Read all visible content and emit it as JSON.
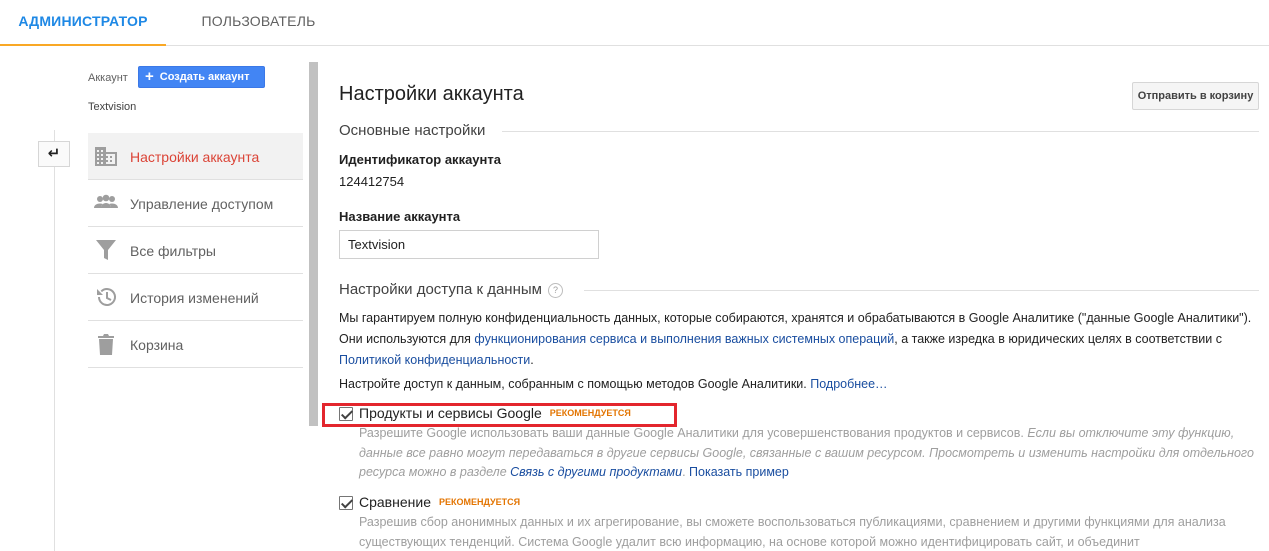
{
  "tabs": {
    "admin": "Администратор",
    "user": "Пользователь"
  },
  "sidebar": {
    "account_label": "Аккаунт",
    "create_button": "Создать аккаунт",
    "account_name": "Textvision",
    "back_icon": "back-arrow-icon",
    "items": [
      {
        "label": "Настройки аккаунта",
        "icon": "building-icon",
        "active": true
      },
      {
        "label": "Управление доступом",
        "icon": "people-icon",
        "active": false
      },
      {
        "label": "Все фильтры",
        "icon": "filter-icon",
        "active": false
      },
      {
        "label": "История изменений",
        "icon": "history-icon",
        "active": false
      },
      {
        "label": "Корзина",
        "icon": "trash-icon",
        "active": false
      }
    ]
  },
  "main": {
    "title": "Настройки аккаунта",
    "trash_button": "Отправить в корзину",
    "basic_section": "Основные настройки",
    "account_id_label": "Идентификатор аккаунта",
    "account_id_value": "124412754",
    "account_name_label": "Название аккаунта",
    "account_name_value": "Textvision",
    "data_section": "Настройки доступа к данным",
    "help_symbol": "?",
    "intro_p1_a": "Мы гарантируем полную конфиденциальность данных, которые собираются, хранятся и обрабатываются в Google Аналитике (\"данные Google Аналитики\"). Они используются для ",
    "intro_p1_link": "функционирования сервиса и выполнения важных системных операций",
    "intro_p1_b": ", а также изредка в юридических целях в соответствии с ",
    "intro_p1_link2": "Политикой конфиденциальности",
    "intro_p1_c": ".",
    "intro_p2_a": "Настройте доступ к данным, собранным с помощью методов Google Аналитики. ",
    "intro_p2_link": "Подробнее…",
    "options": [
      {
        "label": "Продукты и сервисы Google",
        "badge": "Рекомендуется",
        "checked": true,
        "desc_a": "Разрешите Google использовать ваши данные Google Аналитики для усовершенствования продуктов и сервисов. ",
        "desc_it": "Если вы отключите эту функцию, данные все равно могут передаваться в другие сервисы Google, связанные с вашим ресурсом. Просмотреть и изменить настройки для отдельного ресурса можно в разделе ",
        "desc_link_it": "Связь с другими продуктами",
        "desc_b": ". ",
        "desc_link": "Показать пример"
      },
      {
        "label": "Сравнение",
        "badge": "Рекомендуется",
        "checked": true,
        "desc_a": "Разрешив сбор анонимных данных и их агрегирование, вы сможете воспользоваться публикациями, сравнением и другими функциями для анализа существующих тенденций. Система Google удалит всю информацию, на основе которой можно идентифицировать сайт, и объединит"
      }
    ]
  }
}
